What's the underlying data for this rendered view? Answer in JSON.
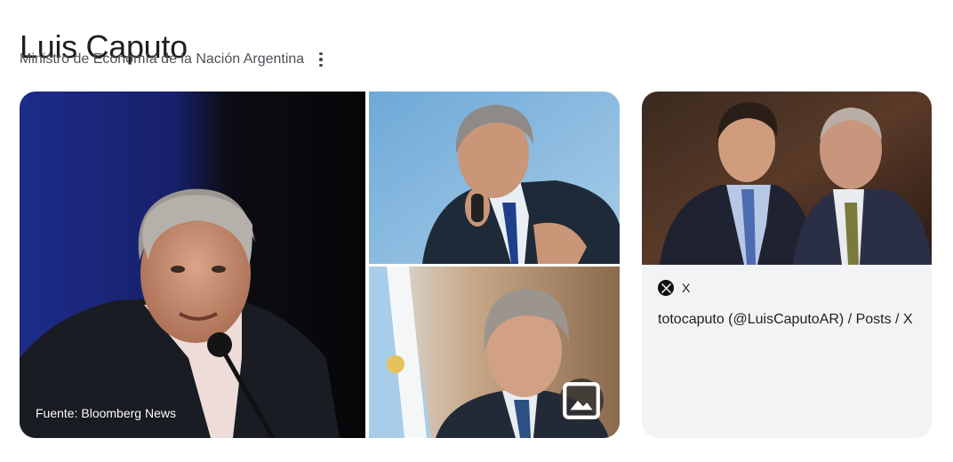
{
  "header": {
    "title": "Luis Caputo",
    "subtitle": "Ministro de Economía de la Nación Argentina",
    "more_icon": "more-vert-icon"
  },
  "gallery": {
    "main_caption": "Fuente: Bloomberg News",
    "images_icon": "image-icon"
  },
  "result_card": {
    "source_icon": "x-logo-icon",
    "source_name": "X",
    "title": "totocaputo (@LuisCaputoAR) / Posts / X"
  }
}
